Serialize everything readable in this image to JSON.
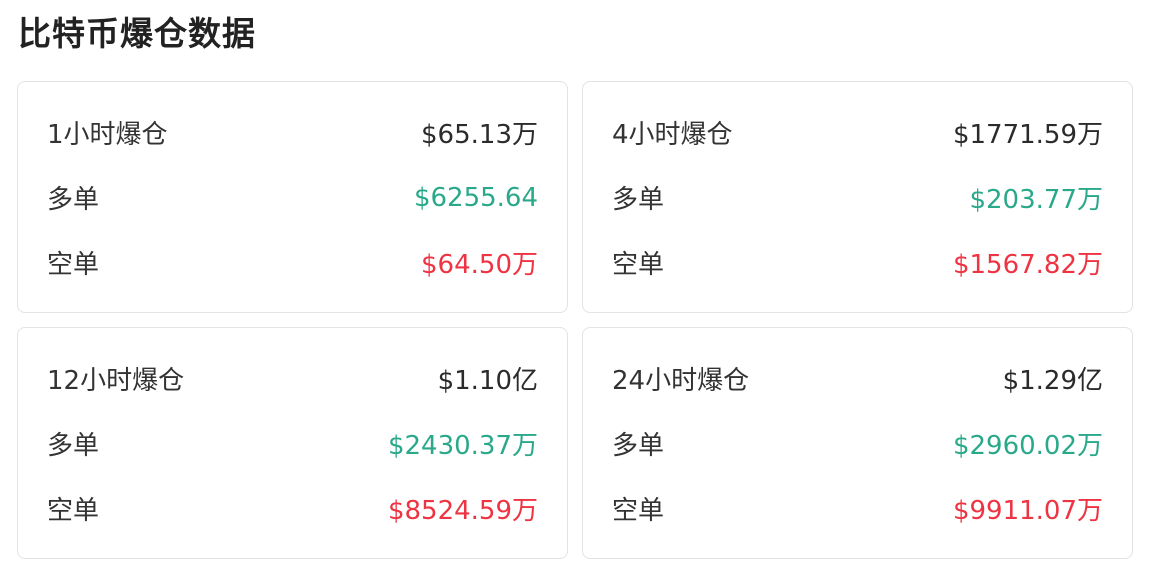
{
  "title": "比特币爆仓数据",
  "colors": {
    "long": "#2aa98a",
    "short": "#ee3342",
    "total": "#2b2b2b"
  },
  "cards": [
    {
      "period_label": "1小时爆仓",
      "total": "$65.13万",
      "long_label": "多单",
      "long": "$6255.64",
      "short_label": "空单",
      "short": "$64.50万"
    },
    {
      "period_label": "4小时爆仓",
      "total": "$1771.59万",
      "long_label": "多单",
      "long": "$203.77万",
      "short_label": "空单",
      "short": "$1567.82万"
    },
    {
      "period_label": "12小时爆仓",
      "total": "$1.10亿",
      "long_label": "多单",
      "long": "$2430.37万",
      "short_label": "空单",
      "short": "$8524.59万"
    },
    {
      "period_label": "24小时爆仓",
      "total": "$1.29亿",
      "long_label": "多单",
      "long": "$2960.02万",
      "short_label": "空单",
      "short": "$9911.07万"
    }
  ]
}
